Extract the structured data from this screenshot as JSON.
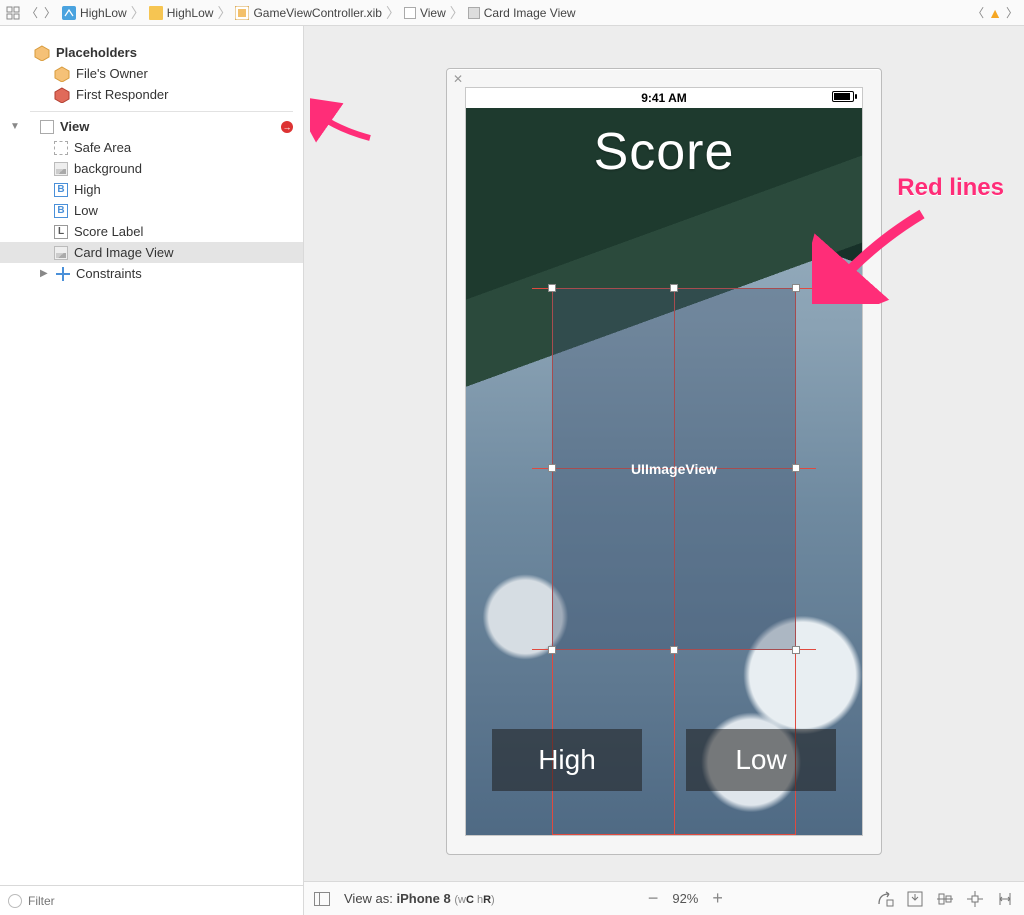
{
  "breadcrumb": {
    "items": [
      {
        "label": "HighLow",
        "icon": "swift"
      },
      {
        "label": "HighLow",
        "icon": "folder"
      },
      {
        "label": "GameViewController.xib",
        "icon": "xib"
      },
      {
        "label": "View",
        "icon": "view"
      },
      {
        "label": "Card Image View",
        "icon": "imgview"
      }
    ]
  },
  "tree": {
    "placeholders_label": "Placeholders",
    "files_owner": "File's Owner",
    "first_responder": "First Responder",
    "view_label": "View",
    "safe_area": "Safe Area",
    "background": "background",
    "high": "High",
    "low": "Low",
    "score_label": "Score Label",
    "card_image_view": "Card Image View",
    "constraints": "Constraints",
    "b_glyph": "B",
    "l_glyph": "L"
  },
  "filter": {
    "placeholder": "Filter"
  },
  "canvas": {
    "status_time": "9:41 AM",
    "score_text": "Score",
    "imgview_text": "UIImageView",
    "btn_high": "High",
    "btn_low": "Low"
  },
  "footer": {
    "view_as_prefix": "View as: ",
    "device": "iPhone 8",
    "wc": "C",
    "hr": "R",
    "w_label": "w",
    "h_label": "h",
    "paren_open": "(",
    "paren_close": ")",
    "zoom": "92%"
  },
  "annotations": {
    "red_lines": "Red lines"
  }
}
